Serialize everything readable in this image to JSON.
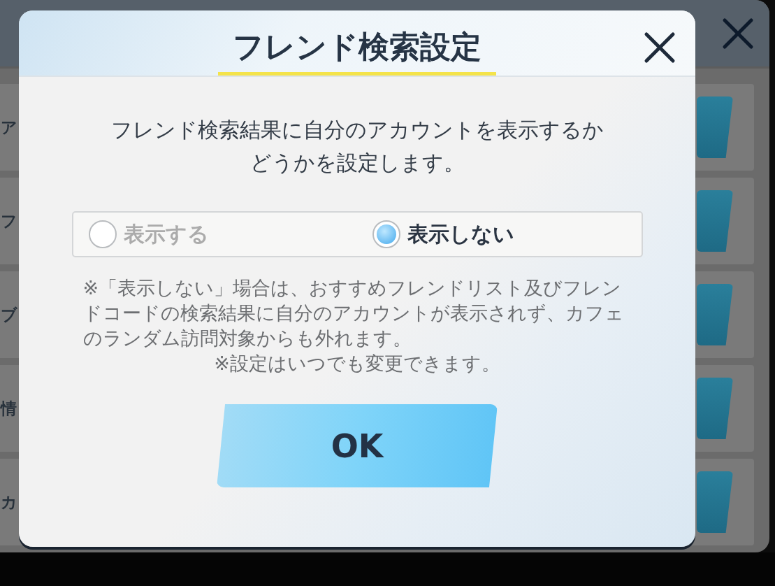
{
  "background": {
    "rows": [
      {
        "label": "ア"
      },
      {
        "label": "フ"
      },
      {
        "label": "ブ"
      },
      {
        "label": "情"
      },
      {
        "label": "カ"
      }
    ]
  },
  "dialog": {
    "title": "フレンド検索設定",
    "description": "フレンド検索結果に自分のアカウントを表示するかどうかを設定します。",
    "options": [
      {
        "label": "表示する",
        "selected": false
      },
      {
        "label": "表示しない",
        "selected": true
      }
    ],
    "notes": [
      "※「表示しない」場合は、おすすめフレンドリスト及びフレンドコードの検索結果に自分のアカウントが表示されず、カフェのランダム訪問対象からも外れます。",
      "※設定はいつでも変更できます。"
    ],
    "ok_button": "OK"
  }
}
